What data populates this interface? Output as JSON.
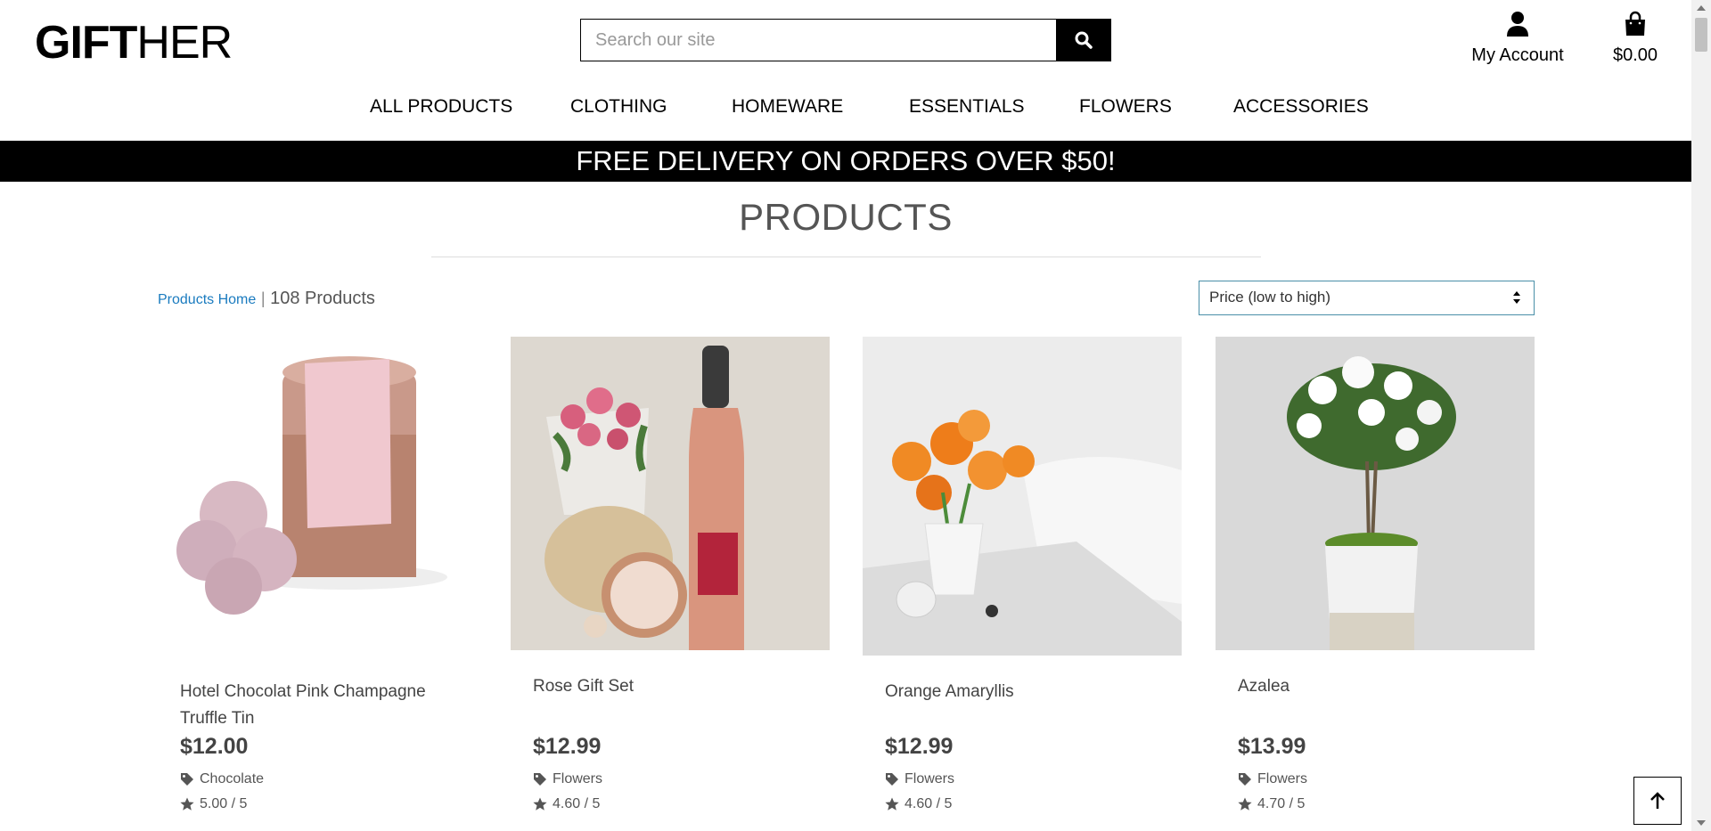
{
  "header": {
    "logo_bold": "GIFT",
    "logo_light": "HER",
    "search_placeholder": "Search our site",
    "account_label": "My Account",
    "bag_total": "$0.00"
  },
  "nav": [
    "ALL PRODUCTS",
    "CLOTHING",
    "HOMEWARE",
    "ESSENTIALS",
    "FLOWERS",
    "ACCESSORIES"
  ],
  "banner": "FREE DELIVERY ON ORDERS OVER $50!",
  "page_title": "PRODUCTS",
  "breadcrumb": {
    "link": "Products Home",
    "separator": "|",
    "count": "108 Products"
  },
  "sort": {
    "selected": "Price (low to high)"
  },
  "products": [
    {
      "name": "Hotel Chocolat Pink Champagne Truffle Tin",
      "price": "$12.00",
      "category": "Chocolate",
      "rating": "5.00 / 5"
    },
    {
      "name": "Rose Gift Set",
      "price": "$12.99",
      "category": "Flowers",
      "rating": "4.60 / 5"
    },
    {
      "name": "Orange Amaryllis",
      "price": "$12.99",
      "category": "Flowers",
      "rating": "4.60 / 5"
    },
    {
      "name": "Azalea",
      "price": "$13.99",
      "category": "Flowers",
      "rating": "4.70 / 5"
    }
  ],
  "colors": {
    "banner_bg": "#000000",
    "link": "#1a7bbf",
    "sort_border": "#4a8fa8",
    "text_grey": "#555555"
  },
  "icons": {
    "search": "search-icon",
    "account": "user-icon",
    "bag": "shopping-bag-icon",
    "tag": "tag-icon",
    "star": "star-icon",
    "top": "arrow-up-icon"
  }
}
